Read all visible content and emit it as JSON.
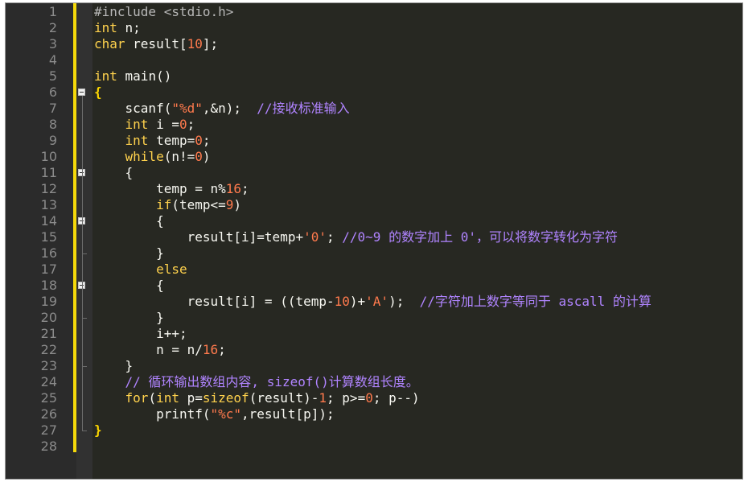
{
  "editor": {
    "line_numbers": [
      "1",
      "2",
      "3",
      "4",
      "5",
      "6",
      "7",
      "8",
      "9",
      "10",
      "11",
      "12",
      "13",
      "14",
      "15",
      "16",
      "17",
      "18",
      "19",
      "20",
      "21",
      "22",
      "23",
      "24",
      "25",
      "26",
      "27",
      "28"
    ],
    "lines": [
      [
        {
          "t": "pre",
          "v": "#include <stdio.h>"
        }
      ],
      [
        {
          "t": "kw",
          "v": "int"
        },
        {
          "t": "plain",
          "v": " n;"
        }
      ],
      [
        {
          "t": "kw",
          "v": "char"
        },
        {
          "t": "plain",
          "v": " result["
        },
        {
          "t": "num",
          "v": "10"
        },
        {
          "t": "plain",
          "v": "];"
        }
      ],
      [],
      [
        {
          "t": "kw",
          "v": "int"
        },
        {
          "t": "plain",
          "v": " main()"
        }
      ],
      [
        {
          "t": "brace",
          "v": "{"
        }
      ],
      [
        {
          "t": "plain",
          "v": "    scanf("
        },
        {
          "t": "str",
          "v": "\"%d\""
        },
        {
          "t": "plain",
          "v": ",&n);  "
        },
        {
          "t": "com",
          "v": "//接收标准输入"
        }
      ],
      [
        {
          "t": "plain",
          "v": "    "
        },
        {
          "t": "kw",
          "v": "int"
        },
        {
          "t": "plain",
          "v": " i ="
        },
        {
          "t": "num",
          "v": "0"
        },
        {
          "t": "plain",
          "v": ";"
        }
      ],
      [
        {
          "t": "plain",
          "v": "    "
        },
        {
          "t": "kw",
          "v": "int"
        },
        {
          "t": "plain",
          "v": " temp="
        },
        {
          "t": "num",
          "v": "0"
        },
        {
          "t": "plain",
          "v": ";"
        }
      ],
      [
        {
          "t": "plain",
          "v": "    "
        },
        {
          "t": "kw",
          "v": "while"
        },
        {
          "t": "plain",
          "v": "(n!="
        },
        {
          "t": "num",
          "v": "0"
        },
        {
          "t": "plain",
          "v": ")"
        }
      ],
      [
        {
          "t": "plain",
          "v": "    {"
        }
      ],
      [
        {
          "t": "plain",
          "v": "        temp = n%"
        },
        {
          "t": "num",
          "v": "16"
        },
        {
          "t": "plain",
          "v": ";"
        }
      ],
      [
        {
          "t": "plain",
          "v": "        "
        },
        {
          "t": "kw",
          "v": "if"
        },
        {
          "t": "plain",
          "v": "(temp<="
        },
        {
          "t": "num",
          "v": "9"
        },
        {
          "t": "plain",
          "v": ")"
        }
      ],
      [
        {
          "t": "plain",
          "v": "        {"
        }
      ],
      [
        {
          "t": "plain",
          "v": "            result[i]=temp+"
        },
        {
          "t": "str",
          "v": "'0'"
        },
        {
          "t": "plain",
          "v": "; "
        },
        {
          "t": "com",
          "v": "//0~9 的数字加上 0'，可以将数字转化为字符"
        }
      ],
      [
        {
          "t": "plain",
          "v": "        }"
        }
      ],
      [
        {
          "t": "plain",
          "v": "        "
        },
        {
          "t": "kw",
          "v": "else"
        }
      ],
      [
        {
          "t": "plain",
          "v": "        {"
        }
      ],
      [
        {
          "t": "plain",
          "v": "            result[i] = ((temp-"
        },
        {
          "t": "num",
          "v": "10"
        },
        {
          "t": "plain",
          "v": ")+"
        },
        {
          "t": "str",
          "v": "'A'"
        },
        {
          "t": "plain",
          "v": ");  "
        },
        {
          "t": "com",
          "v": "//字符加上数字等同于 ascall 的计算"
        }
      ],
      [
        {
          "t": "plain",
          "v": "        }"
        }
      ],
      [
        {
          "t": "plain",
          "v": "        i++;"
        }
      ],
      [
        {
          "t": "plain",
          "v": "        n = n/"
        },
        {
          "t": "num",
          "v": "16"
        },
        {
          "t": "plain",
          "v": ";"
        }
      ],
      [
        {
          "t": "plain",
          "v": "    }"
        }
      ],
      [
        {
          "t": "plain",
          "v": "    "
        },
        {
          "t": "com",
          "v": "// 循环输出数组内容, sizeof()计算数组长度。"
        }
      ],
      [
        {
          "t": "plain",
          "v": "    "
        },
        {
          "t": "kw",
          "v": "for"
        },
        {
          "t": "plain",
          "v": "("
        },
        {
          "t": "kw",
          "v": "int"
        },
        {
          "t": "plain",
          "v": " p="
        },
        {
          "t": "kw",
          "v": "sizeof"
        },
        {
          "t": "plain",
          "v": "(result)-"
        },
        {
          "t": "num",
          "v": "1"
        },
        {
          "t": "plain",
          "v": "; p>="
        },
        {
          "t": "num",
          "v": "0"
        },
        {
          "t": "plain",
          "v": "; p--)"
        }
      ],
      [
        {
          "t": "plain",
          "v": "        printf("
        },
        {
          "t": "str",
          "v": "\"%c\""
        },
        {
          "t": "plain",
          "v": ",result[p]);"
        }
      ],
      [
        {
          "t": "brace",
          "v": "}"
        }
      ],
      []
    ],
    "fold_markers": [
      6,
      11,
      14,
      18
    ]
  },
  "colors": {
    "background": "#272822",
    "keyword": "#ffd24d",
    "number": "#ff7a4d",
    "comment": "#b084ff",
    "change_bar": "#f5d90a"
  }
}
